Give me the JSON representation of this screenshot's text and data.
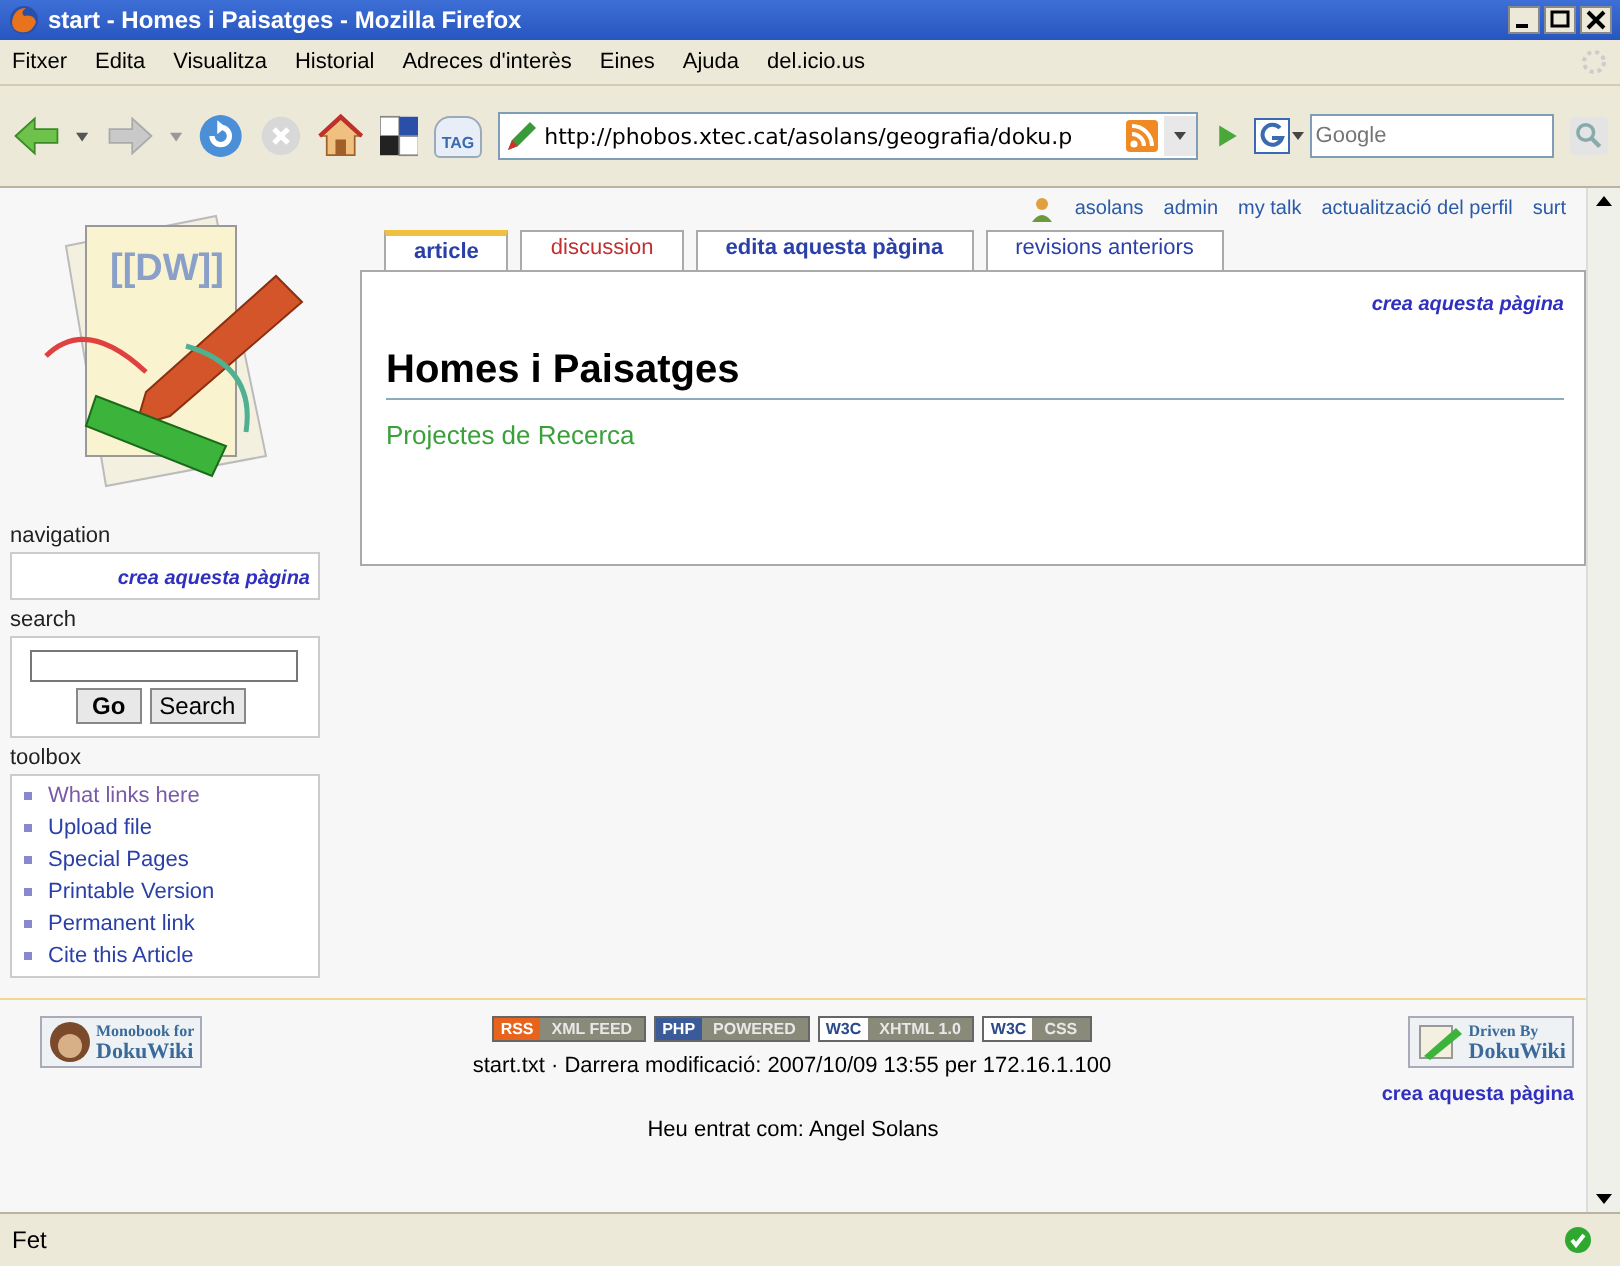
{
  "window": {
    "title": "start - Homes i Paisatges - Mozilla Firefox"
  },
  "menu": [
    "Fitxer",
    "Edita",
    "Visualitza",
    "Historial",
    "Adreces d'interès",
    "Eines",
    "Ajuda",
    "del.icio.us"
  ],
  "toolbar": {
    "tag_label": "TAG",
    "url": "http://phobos.xtec.cat/asolans/geografia/doku.p",
    "search_placeholder": "Google"
  },
  "user_links": [
    "asolans",
    "admin",
    "my talk",
    "actualització del perfil",
    "surt"
  ],
  "logo": {
    "text": "[[DW]]"
  },
  "tabs": [
    {
      "label": "article",
      "selected": true,
      "kind": "normal"
    },
    {
      "label": "discussion",
      "selected": false,
      "kind": "missing"
    },
    {
      "label": "edita aquesta pàgina",
      "selected": false,
      "kind": "bold"
    },
    {
      "label": "revisions anteriors",
      "selected": false,
      "kind": "normal"
    }
  ],
  "page": {
    "action_link": "crea aquesta pàgina",
    "heading": "Homes i Paisatges",
    "link": "Projectes de Recerca"
  },
  "navigation": {
    "title": "navigation",
    "link": "crea aquesta pàgina"
  },
  "search": {
    "title": "search",
    "buttons": [
      "Go",
      "Search"
    ]
  },
  "toolbox": {
    "title": "toolbox",
    "items": [
      {
        "label": "What links here",
        "visited": true
      },
      {
        "label": "Upload file",
        "visited": false
      },
      {
        "label": "Special Pages",
        "visited": false
      },
      {
        "label": "Printable Version",
        "visited": false
      },
      {
        "label": "Permanent link",
        "visited": false
      },
      {
        "label": "Cite this Article",
        "visited": false
      }
    ]
  },
  "footer": {
    "left_badge": [
      "Monobook for",
      "DokuWiki"
    ],
    "badges": [
      {
        "left": "RSS",
        "right": "XML FEED",
        "color": "#e8641c"
      },
      {
        "left": "PHP",
        "right": "POWERED",
        "color": "#3a5a9a"
      },
      {
        "left": "W3C",
        "right": "XHTML 1.0",
        "color": "#ffffff"
      },
      {
        "left": "W3C",
        "right": "CSS",
        "color": "#ffffff"
      }
    ],
    "modified": "start.txt · Darrera modificació: 2007/10/09 13:55 per 172.16.1.100",
    "right_badge": [
      "Driven By",
      "DokuWiki"
    ],
    "right_link": "crea aquesta pàgina",
    "login": "Heu entrat com: Angel Solans"
  },
  "status_bar": {
    "text": "Fet"
  }
}
